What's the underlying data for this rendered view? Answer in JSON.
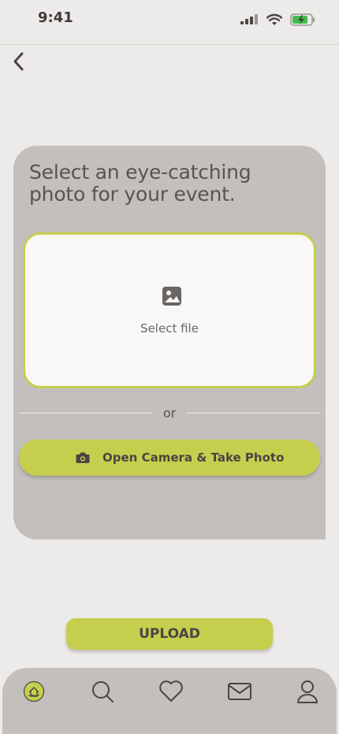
{
  "status_bar": {
    "time": "9:41"
  },
  "main": {
    "heading": "Select an eye-catching photo for your event.",
    "upload_box_label": "Select file",
    "divider_text": "or",
    "camera_button_label": "Open Camera & Take Photo"
  },
  "upload_button_label": "UPLOAD",
  "bottom_nav": {
    "items": [
      "home-icon",
      "search-icon",
      "heart-icon",
      "mail-icon",
      "profile-icon"
    ]
  },
  "colors": {
    "accent": "#c6cf4d",
    "card": "#c3bfbc",
    "background": "#ecebe9",
    "text": "#5a5350"
  }
}
